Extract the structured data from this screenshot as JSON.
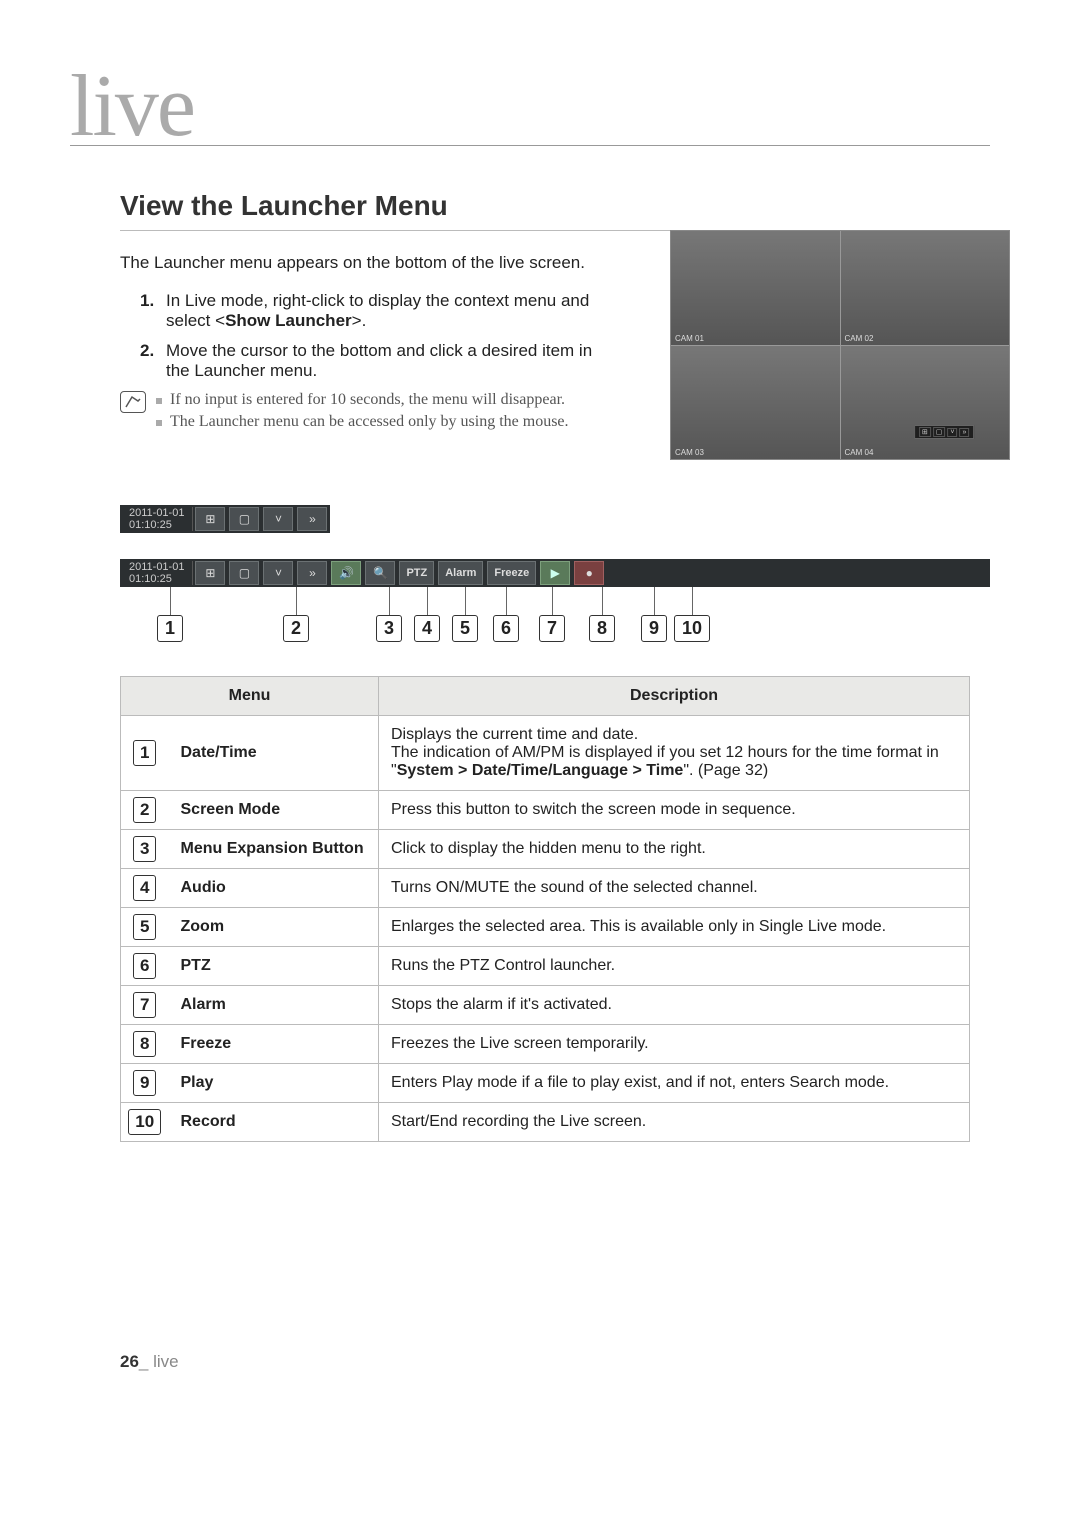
{
  "chapter": "live",
  "section_title": "View the Launcher Menu",
  "intro": "The Launcher menu appears on the bottom of the live screen.",
  "steps": [
    {
      "num": "1.",
      "text_a": "In Live mode, right-click to display the context menu and select <",
      "bold": "Show Launcher",
      "text_b": ">."
    },
    {
      "num": "2.",
      "text_a": "Move the cursor to the bottom and click a desired item in the Launcher menu.",
      "bold": "",
      "text_b": ""
    }
  ],
  "notes": [
    "If no input is entered for 10 seconds, the menu will disappear.",
    "The Launcher menu can be accessed only by using the mouse."
  ],
  "screenshot": {
    "date": "2011-01-01 01:10:25",
    "cams": [
      "CAM 01",
      "CAM 02",
      "CAM 03",
      "CAM 04"
    ],
    "bar_date": "2011-01-01\n01:10:25"
  },
  "launcher": {
    "date_line1": "2011-01-01",
    "date_line2": "01:10:25",
    "icons": {
      "grid4": "⊞",
      "grid1": "▢",
      "dropdown": "˅",
      "expand": "»",
      "audio": "🔊",
      "zoom": "🔍",
      "ptz": "PTZ",
      "alarm": "Alarm",
      "freeze": "Freeze",
      "play": "▶",
      "record": "●"
    }
  },
  "callout_numbers": [
    "1",
    "2",
    "3",
    "4",
    "5",
    "6",
    "7",
    "8",
    "9",
    "10"
  ],
  "table": {
    "head_menu": "Menu",
    "head_desc": "Description",
    "rows": [
      {
        "n": "1",
        "menu": "Date/Time",
        "desc_a": "Displays the current time and date.\nThe indication of AM/PM is displayed if you set 12 hours for the time format in \"",
        "bold": "System > Date/Time/Language > Time",
        "desc_b": "\". (Page 32)"
      },
      {
        "n": "2",
        "menu": "Screen Mode",
        "desc_a": "Press this button to switch the screen mode in sequence.",
        "bold": "",
        "desc_b": ""
      },
      {
        "n": "3",
        "menu": "Menu Expansion Button",
        "desc_a": "Click to display the hidden menu to the right.",
        "bold": "",
        "desc_b": ""
      },
      {
        "n": "4",
        "menu": "Audio",
        "desc_a": "Turns ON/MUTE the sound of the selected channel.",
        "bold": "",
        "desc_b": ""
      },
      {
        "n": "5",
        "menu": "Zoom",
        "desc_a": "Enlarges the selected area. This is available only in Single Live mode.",
        "bold": "",
        "desc_b": ""
      },
      {
        "n": "6",
        "menu": "PTZ",
        "desc_a": "Runs the PTZ Control launcher.",
        "bold": "",
        "desc_b": ""
      },
      {
        "n": "7",
        "menu": "Alarm",
        "desc_a": "Stops the alarm if it's activated.",
        "bold": "",
        "desc_b": ""
      },
      {
        "n": "8",
        "menu": "Freeze",
        "desc_a": "Freezes the Live screen temporarily.",
        "bold": "",
        "desc_b": ""
      },
      {
        "n": "9",
        "menu": "Play",
        "desc_a": "Enters Play mode if a file to play exist, and if not, enters Search mode.",
        "bold": "",
        "desc_b": ""
      },
      {
        "n": "10",
        "menu": "Record",
        "desc_a": "Start/End recording the Live screen.",
        "bold": "",
        "desc_b": ""
      }
    ]
  },
  "footer": {
    "page": "26",
    "label": "_ live"
  }
}
